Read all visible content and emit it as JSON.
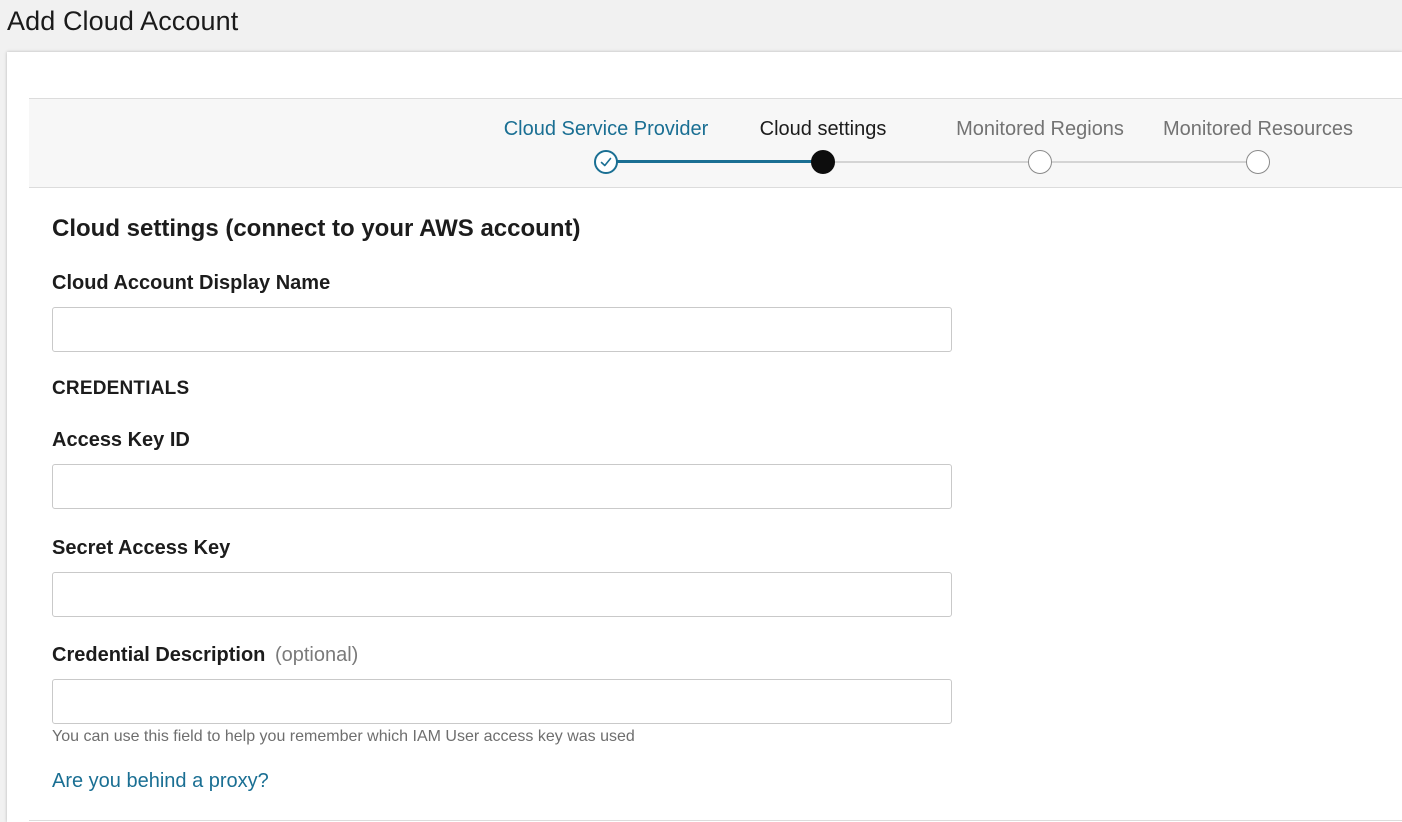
{
  "page": {
    "title": "Add Cloud Account"
  },
  "stepper": {
    "steps": [
      {
        "label": "Cloud Service Provider",
        "status": "done"
      },
      {
        "label": "Cloud settings",
        "status": "active"
      },
      {
        "label": "Monitored Regions",
        "status": "pending"
      },
      {
        "label": "Monitored Resources",
        "status": "pending"
      }
    ]
  },
  "form": {
    "heading": "Cloud settings (connect to your AWS account)",
    "display_name": {
      "label": "Cloud Account Display Name",
      "value": "",
      "placeholder": ""
    },
    "credentials_label": "CREDENTIALS",
    "access_key_id": {
      "label": "Access Key ID",
      "value": "",
      "placeholder": ""
    },
    "secret_access_key": {
      "label": "Secret Access Key",
      "value": "",
      "placeholder": ""
    },
    "credential_description": {
      "label": "Credential Description",
      "optional_label": "(optional)",
      "value": "",
      "placeholder": "",
      "help_text": "You can use this field to help you remember which IAM User access key was used"
    },
    "proxy_link": "Are you behind a proxy?"
  },
  "colors": {
    "accent": "#1a6f93",
    "active_step": "#0d0d0d",
    "pending_step": "#8a8a8a"
  }
}
